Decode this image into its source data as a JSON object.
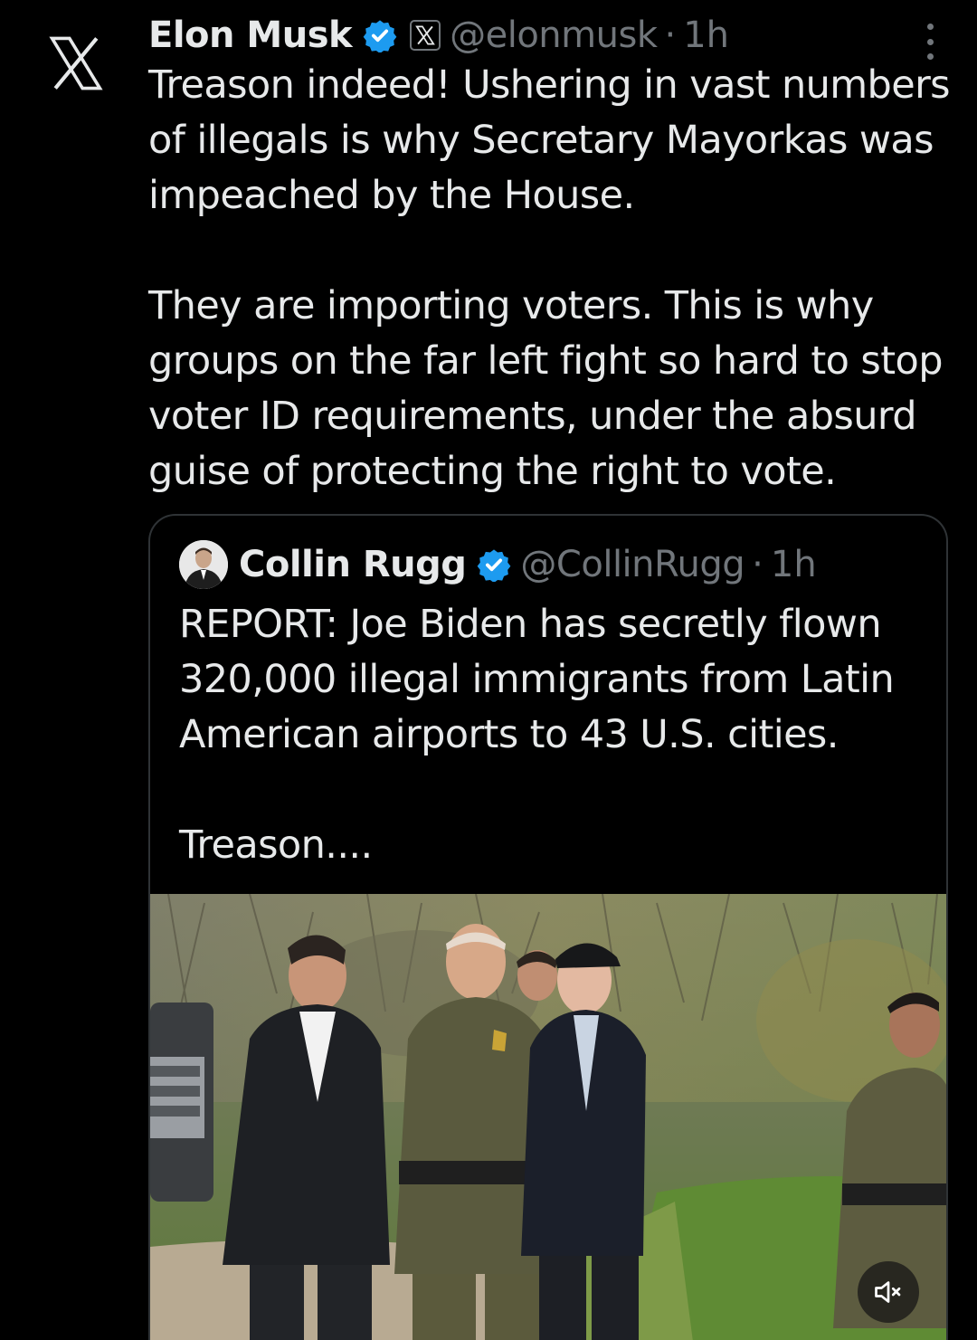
{
  "tweet": {
    "author_name": "Elon Musk",
    "handle": "@elonmusk",
    "separator": "·",
    "time": "1h",
    "text": "Treason indeed! Ushering in vast numbers of illegals is why Secretary Mayorkas was impeached by the House.\n\nThey are importing voters. This is why groups on the far left fight so hard to stop voter ID requirements, under the absurd guise of protecting the right to vote."
  },
  "quoted_tweet": {
    "author_name": "Collin Rugg",
    "handle": "@CollinRugg",
    "separator": "·",
    "time": "1h",
    "text": "REPORT: Joe Biden has secretly flown 320,000 illegal immigrants from Latin American airports to 43 U.S. cities.\n\nTreason....",
    "media_type": "video",
    "muted": true
  },
  "icons": {
    "avatar": "x-logo-icon",
    "verified": "verified-badge-icon",
    "affiliate": "x-affiliate-badge-icon",
    "menu": "more-vertical-icon",
    "mute": "volume-muted-icon"
  },
  "colors": {
    "background": "#000000",
    "text": "#e7e9ea",
    "secondary": "#71767b",
    "verified": "#1d9bf0",
    "border": "#2f3336"
  }
}
